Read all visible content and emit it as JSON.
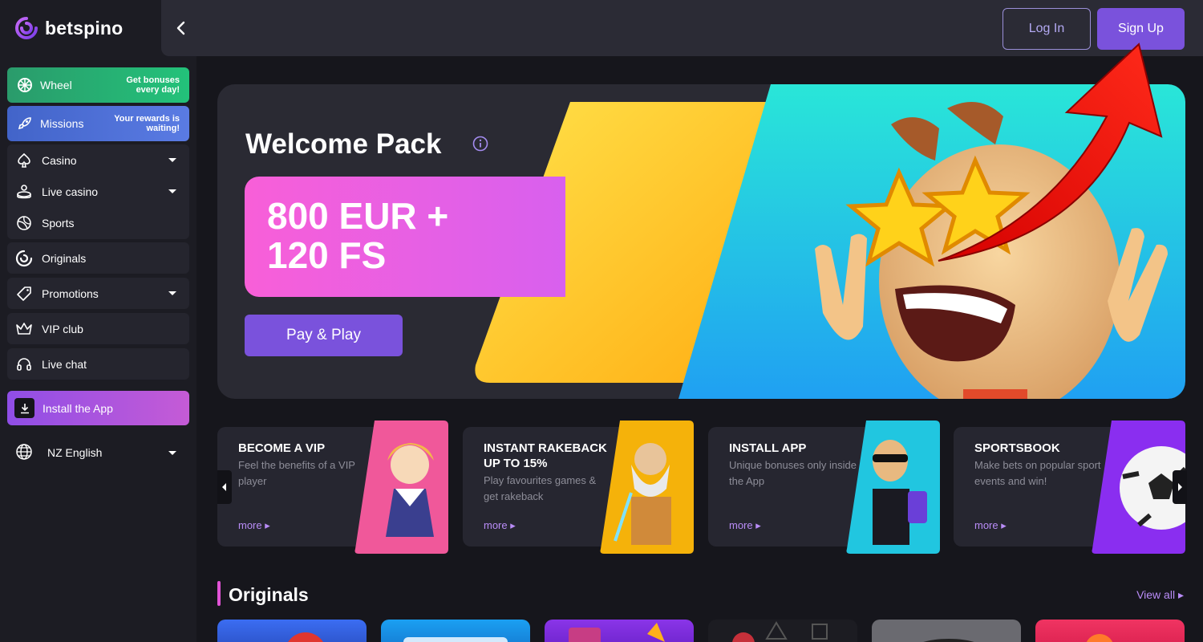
{
  "brand": {
    "name": "betspino"
  },
  "header": {
    "login_label": "Log In",
    "signup_label": "Sign Up"
  },
  "sidebar": {
    "wheel": {
      "label": "Wheel",
      "sub": "Get bonuses every day!"
    },
    "missions": {
      "label": "Missions",
      "sub": "Your rewards is waiting!"
    },
    "group1": [
      {
        "label": "Casino",
        "icon": "spade-icon",
        "has_caret": true
      },
      {
        "label": "Live casino",
        "icon": "dealer-icon",
        "has_caret": true
      },
      {
        "label": "Sports",
        "icon": "ball-icon",
        "has_caret": false
      }
    ],
    "originals": {
      "label": "Originals",
      "icon": "spiral-icon"
    },
    "promotions": {
      "label": "Promotions",
      "icon": "tag-icon"
    },
    "vip": {
      "label": "VIP club",
      "icon": "crown-icon"
    },
    "chat": {
      "label": "Live chat",
      "icon": "headset-icon"
    },
    "install": {
      "label": "Install the App",
      "icon": "download-icon"
    },
    "language": {
      "label": "NZ English",
      "icon": "globe-icon"
    }
  },
  "hero": {
    "title": "Welcome Pack",
    "amount_line1": "800 EUR +",
    "amount_line2": "120 FS",
    "cta": "Pay & Play"
  },
  "cards": [
    {
      "title": "BECOME A VIP",
      "desc": "Feel the benefits of a VIP player",
      "more": "more",
      "accent": "#f0589a"
    },
    {
      "title": "INSTANT RAKEBACK UP TO 15%",
      "desc": "Play favourites games & get rakeback",
      "more": "more",
      "accent": "#f5b20a"
    },
    {
      "title": "INSTALL APP",
      "desc": "Unique bonuses only inside the App",
      "more": "more",
      "accent": "#21c6e0"
    },
    {
      "title": "SPORTSBOOK",
      "desc": "Make bets on popular sport events and win!",
      "more": "more",
      "accent": "#8a2ef0"
    }
  ],
  "originals": {
    "title": "Originals",
    "view_all": "View all"
  },
  "colors": {
    "accent": "#7a52dc",
    "bg": "#16161c",
    "card": "#262630",
    "link": "#b98cf7"
  }
}
